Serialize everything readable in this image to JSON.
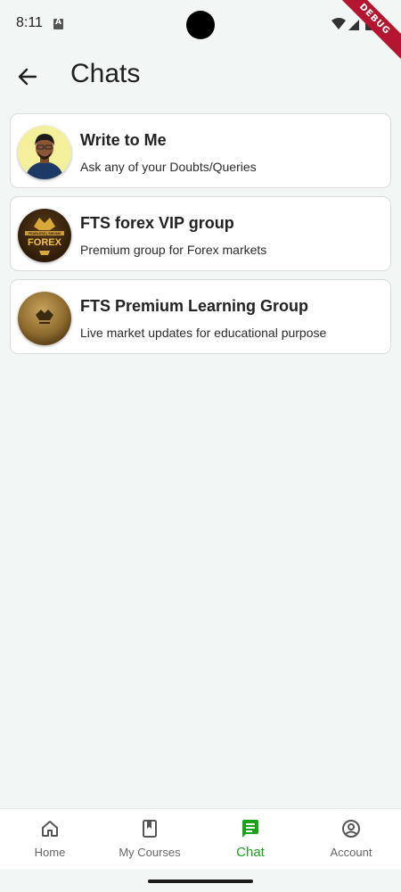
{
  "status_bar": {
    "time": "8:11",
    "debug_label": "DEBUG"
  },
  "header": {
    "title": "Chats"
  },
  "chats": [
    {
      "title": "Write to Me",
      "subtitle": "Ask any of your Doubts/Queries",
      "avatar": "person-photo"
    },
    {
      "title": "FTS forex VIP group",
      "subtitle": "Premium group for Forex markets",
      "avatar": "forex-logo"
    },
    {
      "title": "FTS Premium Learning Group",
      "subtitle": "Live market updates for educational purpose",
      "avatar": "gold-bull-logo"
    }
  ],
  "avatar_text": {
    "forex_brand": "FEARLESS | SHIVAM",
    "forex_word": "FOREX"
  },
  "bottom_nav": {
    "items": [
      {
        "label": "Home",
        "icon": "home-icon"
      },
      {
        "label": "My Courses",
        "icon": "book-icon"
      },
      {
        "label": "Chat",
        "icon": "chat-icon",
        "active": true
      },
      {
        "label": "Account",
        "icon": "account-icon"
      }
    ]
  },
  "colors": {
    "background": "#f2f6f5",
    "accent": "#1aa31a",
    "debug": "#b3162e"
  }
}
